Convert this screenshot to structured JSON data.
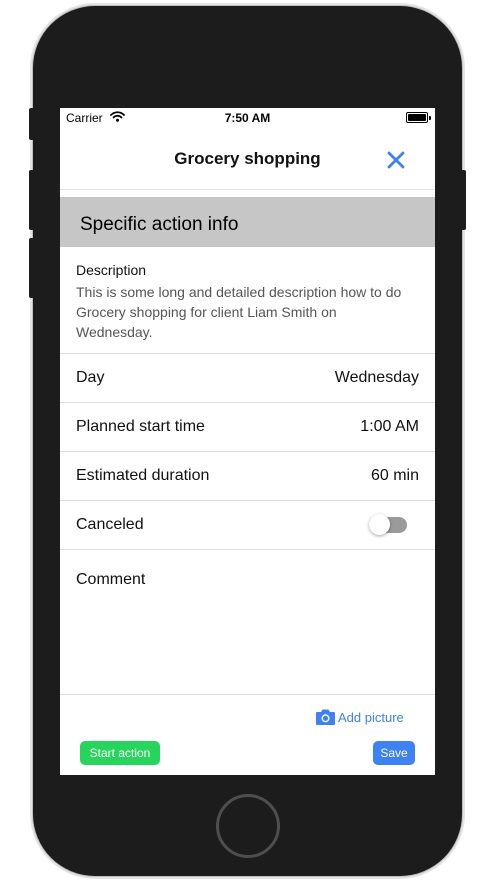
{
  "status_bar": {
    "carrier": "Carrier",
    "time": "7:50 AM"
  },
  "nav": {
    "title": "Grocery shopping",
    "close_icon": "close-icon"
  },
  "section": {
    "title": "Specific action info"
  },
  "description": {
    "label": "Description",
    "text": " This is some long and detailed description how to do Grocery shopping for client Liam Smith on Wednesday."
  },
  "rows": [
    {
      "label": "Day",
      "value": "Wednesday"
    },
    {
      "label": "Planned start time",
      "value": "1:00 AM"
    },
    {
      "label": "Estimated duration",
      "value": "60 min"
    },
    {
      "label": "Canceled",
      "toggle_on": false
    }
  ],
  "comment": {
    "label": "Comment",
    "value": ""
  },
  "actions": {
    "add_picture": "Add picture",
    "start": "Start action",
    "save": "Save"
  },
  "colors": {
    "accent": "#3d82f0",
    "start_green": "#27d45c",
    "section_bg": "#c6c6c6",
    "device_body": "#1c1c1c"
  }
}
